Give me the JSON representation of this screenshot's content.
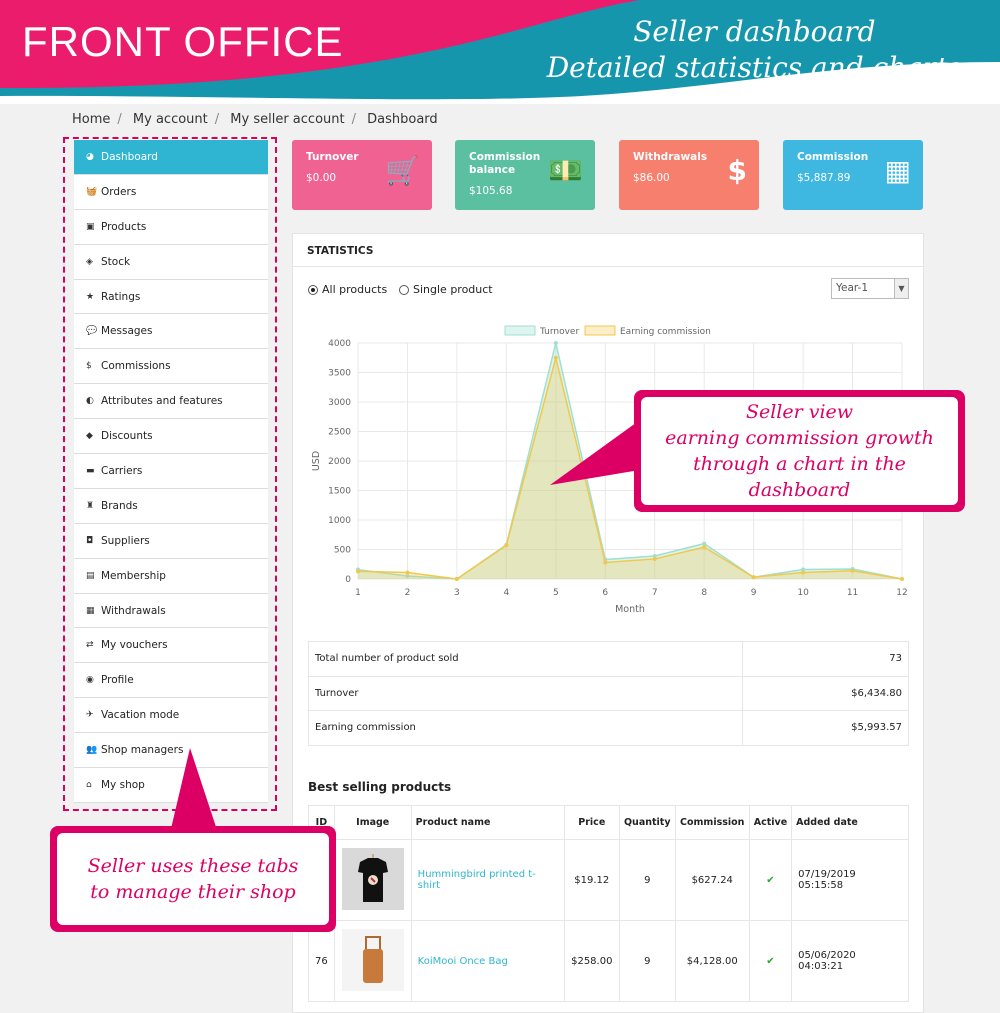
{
  "banner": {
    "left": "FRONT OFFICE",
    "right_line1": "Seller dashboard",
    "right_line2": "Detailed statistics and charts"
  },
  "breadcrumb": [
    "Home",
    "My account",
    "My seller account",
    "Dashboard"
  ],
  "sidebar": {
    "items": [
      {
        "label": "Dashboard",
        "icon": "dashboard-icon",
        "glyph": "◕",
        "active": true
      },
      {
        "label": "Orders",
        "icon": "basket-icon",
        "glyph": "🧺"
      },
      {
        "label": "Products",
        "icon": "gift-icon",
        "glyph": "▣"
      },
      {
        "label": "Stock",
        "icon": "cubes-icon",
        "glyph": "◈"
      },
      {
        "label": "Ratings",
        "icon": "star-icon",
        "glyph": "★"
      },
      {
        "label": "Messages",
        "icon": "comment-icon",
        "glyph": "💬"
      },
      {
        "label": "Commissions",
        "icon": "dollar-icon",
        "glyph": "$"
      },
      {
        "label": "Attributes and features",
        "icon": "contrast-icon",
        "glyph": "◐"
      },
      {
        "label": "Discounts",
        "icon": "tag-icon",
        "glyph": "◆"
      },
      {
        "label": "Carriers",
        "icon": "truck-icon",
        "glyph": "▬"
      },
      {
        "label": "Brands",
        "icon": "trophy-icon",
        "glyph": "♜"
      },
      {
        "label": "Suppliers",
        "icon": "box-icon",
        "glyph": "◘"
      },
      {
        "label": "Membership",
        "icon": "card-icon",
        "glyph": "▤"
      },
      {
        "label": "Withdrawals",
        "icon": "money-icon",
        "glyph": "▦"
      },
      {
        "label": "My vouchers",
        "icon": "exchange-icon",
        "glyph": "⇄"
      },
      {
        "label": "Profile",
        "icon": "user-icon",
        "glyph": "◉"
      },
      {
        "label": "Vacation mode",
        "icon": "plane-icon",
        "glyph": "✈"
      },
      {
        "label": "Shop managers",
        "icon": "users-icon",
        "glyph": "👥"
      },
      {
        "label": "My shop",
        "icon": "home-icon",
        "glyph": "⌂"
      }
    ]
  },
  "cards": [
    {
      "title": "Turnover",
      "value": "$0.00",
      "color": "#f06292",
      "icon": "cart-icon",
      "glyph": "🛒"
    },
    {
      "title": "Commission balance",
      "value": "$105.68",
      "color": "#5bc0a0",
      "icon": "banknote-icon",
      "glyph": "💵"
    },
    {
      "title": "Withdrawals",
      "value": "$86.00",
      "color": "#f77f6e",
      "icon": "dollar-icon",
      "glyph": "$"
    },
    {
      "title": "Commission",
      "value": "$5,887.89",
      "color": "#3eb8e0",
      "icon": "grid-icon",
      "glyph": "▦"
    }
  ],
  "statistics": {
    "title": "STATISTICS",
    "radio_all": "All products",
    "radio_single": "Single product",
    "selected": "all",
    "period_select": "Year-1"
  },
  "chart_data": {
    "type": "area",
    "title": "",
    "xlabel": "Month",
    "ylabel": "USD",
    "x": [
      1,
      2,
      3,
      4,
      5,
      6,
      7,
      8,
      9,
      10,
      11,
      12
    ],
    "ylim": [
      0,
      4000
    ],
    "yticks": [
      0,
      500,
      1000,
      1500,
      2000,
      2500,
      3000,
      3500,
      4000
    ],
    "grid": true,
    "legend": "top",
    "series": [
      {
        "name": "Turnover",
        "values": [
          160,
          50,
          0,
          580,
          4000,
          330,
          390,
          600,
          30,
          160,
          170,
          0
        ],
        "color": "#9fe0d0",
        "fill": "rgba(160,224,208,0.35)"
      },
      {
        "name": "Earning commission",
        "values": [
          130,
          110,
          0,
          570,
          3750,
          280,
          340,
          540,
          30,
          110,
          140,
          0
        ],
        "color": "#f2c84b",
        "fill": "rgba(242,200,75,0.3)"
      }
    ]
  },
  "summary": [
    {
      "label": "Total number of product sold",
      "value": "73"
    },
    {
      "label": "Turnover",
      "value": "$6,434.80"
    },
    {
      "label": "Earning commission",
      "value": "$5,993.57"
    }
  ],
  "best": {
    "title": "Best selling products",
    "headers": [
      "ID",
      "Image",
      "Product name",
      "Price",
      "Quantity",
      "Commission",
      "Active",
      "Added date"
    ],
    "rows": [
      {
        "id": "",
        "name": "Hummingbird printed t-shirt",
        "price": "$19.12",
        "qty": "9",
        "commission": "$627.24",
        "active": true,
        "date": "07/19/2019 05:15:58"
      },
      {
        "id": "76",
        "name": "KoiMooi Once Bag",
        "price": "$258.00",
        "qty": "9",
        "commission": "$4,128.00",
        "active": true,
        "date": "05/06/2020 04:03:21"
      }
    ]
  },
  "callouts": {
    "chart": [
      "Seller view",
      "earning commission growth",
      "through a chart in the dashboard"
    ],
    "sidebar": [
      "Seller uses these tabs",
      "to manage their shop"
    ]
  }
}
